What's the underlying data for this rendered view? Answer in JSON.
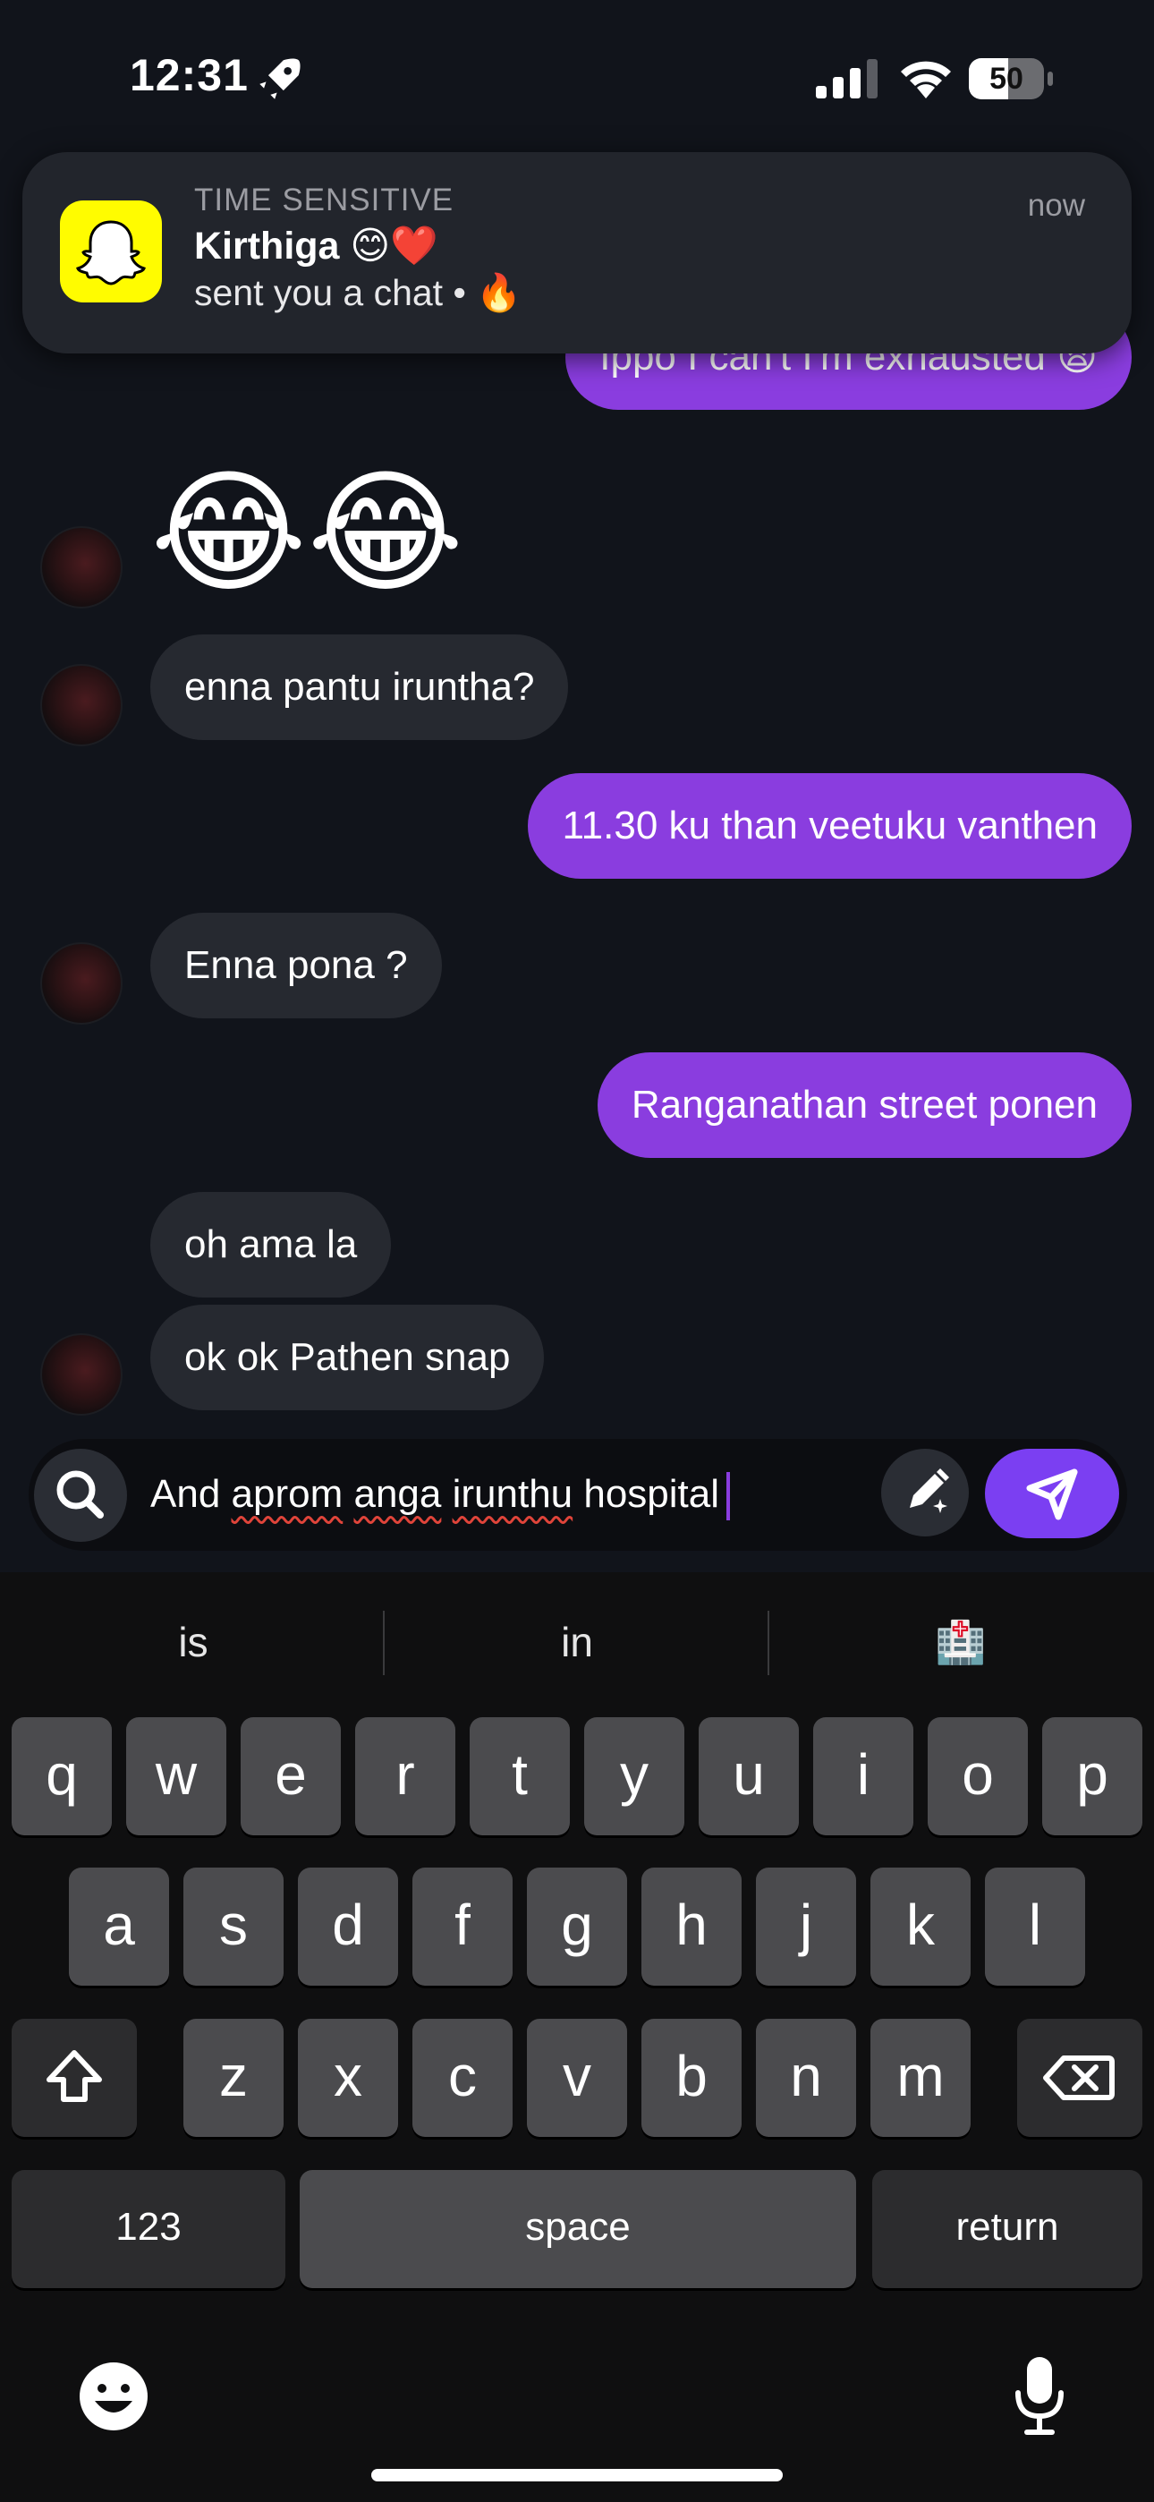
{
  "status_bar": {
    "time": "12:31",
    "battery": "50"
  },
  "notification": {
    "kicker": "TIME SENSITIVE",
    "title": "Kirthiga 😊❤️",
    "body": "sent you a chat • 🔥",
    "time": "now"
  },
  "messages": [
    {
      "direction": "out",
      "text": "Ippo I can't I'm exhausted 😩"
    },
    {
      "direction": "in",
      "text": "😂😂"
    },
    {
      "direction": "in",
      "text": "enna pantu iruntha?"
    },
    {
      "direction": "out",
      "text": "11.30 ku than veetuku vanthen"
    },
    {
      "direction": "in",
      "text": "Enna pona ?"
    },
    {
      "direction": "out",
      "text": "Ranganathan street ponen"
    },
    {
      "direction": "in",
      "text": "oh ama la"
    },
    {
      "direction": "in",
      "text": "ok ok Pathen snap"
    }
  ],
  "composer": {
    "w1": "And ",
    "w2": "aprom",
    "w3": " ",
    "w4": "anga",
    "w5": " ",
    "w6": "irunthu",
    "w7": " hospital"
  },
  "suggestions": [
    "is",
    "in",
    "🏥"
  ],
  "keyboard": {
    "row1": [
      "q",
      "w",
      "e",
      "r",
      "t",
      "y",
      "u",
      "i",
      "o",
      "p"
    ],
    "row2": [
      "a",
      "s",
      "d",
      "f",
      "g",
      "h",
      "j",
      "k",
      "l"
    ],
    "row3": [
      "z",
      "x",
      "c",
      "v",
      "b",
      "n",
      "m"
    ],
    "numbers": "123",
    "space": "space",
    "return": "return"
  },
  "colors": {
    "outgoing_bubble": "#8a3ddf",
    "incoming_bubble": "#262930",
    "snapchat_yellow": "#fffc00",
    "send_button": "#7b3ff2"
  }
}
